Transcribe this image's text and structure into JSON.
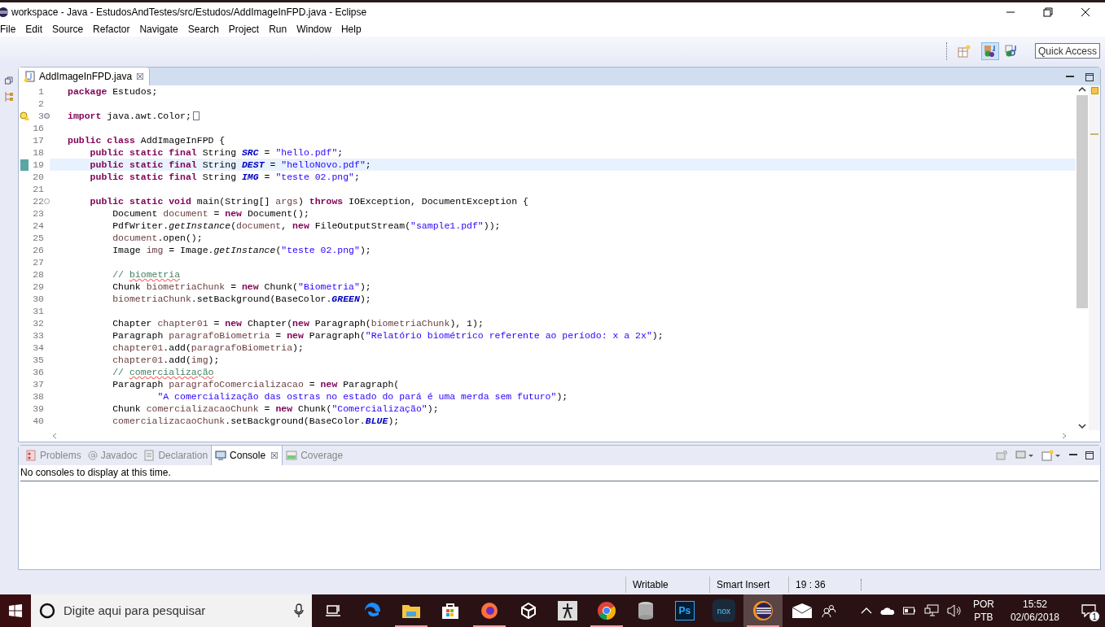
{
  "window": {
    "title": "workspace - Java - EstudosAndTestes/src/Estudos/AddImageInFPD.java - Eclipse"
  },
  "menu": [
    "File",
    "Edit",
    "Source",
    "Refactor",
    "Navigate",
    "Search",
    "Project",
    "Run",
    "Window",
    "Help"
  ],
  "toolbar": {
    "quick_access": "Quick Access",
    "buttons": [
      {
        "kind": "open-perspective",
        "selected": false
      },
      {
        "kind": "java-perspective",
        "selected": true
      },
      {
        "kind": "debug-perspective",
        "selected": false
      }
    ]
  },
  "editor": {
    "tab": {
      "label": "AddImageInFPD.java",
      "close": "☒"
    },
    "lines": [
      {
        "number": "1",
        "tokens": [
          {
            "kind": "keyword",
            "text": "package"
          },
          {
            "kind": "plain",
            "text": " Estudos;"
          }
        ]
      },
      {
        "number": "2"
      },
      {
        "number": "3",
        "warning": true,
        "expanded": false,
        "tokens": [
          {
            "kind": "keyword",
            "text": "import"
          },
          {
            "kind": "plain",
            "text": " java.awt.Color;"
          }
        ]
      },
      {
        "number": "16"
      },
      {
        "number": "17",
        "tokens": [
          {
            "kind": "keyword",
            "text": "public class"
          },
          {
            "kind": "plain",
            "text": " AddImageInFPD {"
          }
        ]
      },
      {
        "number": "18",
        "tokens": [
          {
            "kind": "keyword",
            "text": "    public static final"
          },
          {
            "kind": "plain",
            "text": " String "
          },
          {
            "kind": "constant",
            "text": "SRC"
          },
          {
            "kind": "plain",
            "text": " = "
          },
          {
            "kind": "string",
            "text": "\"hello.pdf\""
          },
          {
            "kind": "plain",
            "text": ";"
          }
        ]
      },
      {
        "number": "19",
        "current": true,
        "tokens": [
          {
            "kind": "keyword",
            "text": "    public static final"
          },
          {
            "kind": "plain",
            "text": " String "
          },
          {
            "kind": "constant",
            "text": "DEST"
          },
          {
            "kind": "plain",
            "text": " = "
          },
          {
            "kind": "string",
            "text": "\"helloNovo.pdf\""
          },
          {
            "kind": "plain",
            "text": ";"
          }
        ]
      },
      {
        "number": "20",
        "tokens": [
          {
            "kind": "keyword",
            "text": "    public static final"
          },
          {
            "kind": "plain",
            "text": " String "
          },
          {
            "kind": "constant",
            "text": "IMG"
          },
          {
            "kind": "plain",
            "text": " = "
          },
          {
            "kind": "string",
            "text": "\"teste 02.png\""
          },
          {
            "kind": "plain",
            "text": ";"
          }
        ]
      },
      {
        "number": "21"
      },
      {
        "number": "22",
        "expanded": true,
        "tokens": [
          {
            "kind": "keyword",
            "text": "    public static void"
          },
          {
            "kind": "plain",
            "text": " main(String[] "
          },
          {
            "kind": "local",
            "text": "args"
          },
          {
            "kind": "plain",
            "text": ") "
          },
          {
            "kind": "keyword",
            "text": "throws"
          },
          {
            "kind": "plain",
            "text": " IOException, DocumentException {"
          }
        ]
      },
      {
        "number": "23",
        "tokens": [
          {
            "kind": "plain",
            "text": "        Document "
          },
          {
            "kind": "local",
            "text": "document"
          },
          {
            "kind": "plain",
            "text": " = "
          },
          {
            "kind": "keyword",
            "text": "new"
          },
          {
            "kind": "plain",
            "text": " Document();"
          }
        ]
      },
      {
        "number": "24",
        "tokens": [
          {
            "kind": "plain",
            "text": "        PdfWriter."
          },
          {
            "kind": "static_method",
            "text": "getInstance"
          },
          {
            "kind": "plain",
            "text": "("
          },
          {
            "kind": "local",
            "text": "document"
          },
          {
            "kind": "plain",
            "text": ", "
          },
          {
            "kind": "keyword",
            "text": "new"
          },
          {
            "kind": "plain",
            "text": " FileOutputStream("
          },
          {
            "kind": "string",
            "text": "\"sample1.pdf\""
          },
          {
            "kind": "plain",
            "text": "));"
          }
        ]
      },
      {
        "number": "25",
        "tokens": [
          {
            "kind": "local",
            "text": "        document"
          },
          {
            "kind": "plain",
            "text": ".open();"
          }
        ]
      },
      {
        "number": "26",
        "tokens": [
          {
            "kind": "plain",
            "text": "        Image "
          },
          {
            "kind": "local",
            "text": "img"
          },
          {
            "kind": "plain",
            "text": " = Image."
          },
          {
            "kind": "static_method",
            "text": "getInstance"
          },
          {
            "kind": "plain",
            "text": "("
          },
          {
            "kind": "string",
            "text": "\"teste 02.png\""
          },
          {
            "kind": "plain",
            "text": ");"
          }
        ]
      },
      {
        "number": "27"
      },
      {
        "number": "28",
        "tokens": [
          {
            "kind": "comment",
            "text": "        // "
          },
          {
            "kind": "misspelled",
            "text": "biometria"
          }
        ]
      },
      {
        "number": "29",
        "tokens": [
          {
            "kind": "plain",
            "text": "        Chunk "
          },
          {
            "kind": "local",
            "text": "biometriaChunk"
          },
          {
            "kind": "plain",
            "text": " = "
          },
          {
            "kind": "keyword",
            "text": "new"
          },
          {
            "kind": "plain",
            "text": " Chunk("
          },
          {
            "kind": "string",
            "text": "\"Biometria\""
          },
          {
            "kind": "plain",
            "text": ");"
          }
        ]
      },
      {
        "number": "30",
        "tokens": [
          {
            "kind": "local",
            "text": "        biometriaChunk"
          },
          {
            "kind": "plain",
            "text": ".setBackground(BaseColor."
          },
          {
            "kind": "constant",
            "text": "GREEN"
          },
          {
            "kind": "plain",
            "text": ");"
          }
        ]
      },
      {
        "number": "31"
      },
      {
        "number": "32",
        "tokens": [
          {
            "kind": "plain",
            "text": "        Chapter "
          },
          {
            "kind": "local",
            "text": "chapter01"
          },
          {
            "kind": "plain",
            "text": " = "
          },
          {
            "kind": "keyword",
            "text": "new"
          },
          {
            "kind": "plain",
            "text": " Chapter("
          },
          {
            "kind": "keyword",
            "text": "new"
          },
          {
            "kind": "plain",
            "text": " Paragraph("
          },
          {
            "kind": "local",
            "text": "biometriaChunk"
          },
          {
            "kind": "plain",
            "text": "), 1);"
          }
        ]
      },
      {
        "number": "33",
        "tokens": [
          {
            "kind": "plain",
            "text": "        Paragraph "
          },
          {
            "kind": "local",
            "text": "paragrafoBiometria"
          },
          {
            "kind": "plain",
            "text": " = "
          },
          {
            "kind": "keyword",
            "text": "new"
          },
          {
            "kind": "plain",
            "text": " Paragraph("
          },
          {
            "kind": "string",
            "text": "\"Relatório biométrico referente ao período: x a 2x\""
          },
          {
            "kind": "plain",
            "text": ");"
          }
        ]
      },
      {
        "number": "34",
        "tokens": [
          {
            "kind": "local",
            "text": "        chapter01"
          },
          {
            "kind": "plain",
            "text": ".add("
          },
          {
            "kind": "local",
            "text": "paragrafoBiometria"
          },
          {
            "kind": "plain",
            "text": ");"
          }
        ]
      },
      {
        "number": "35",
        "tokens": [
          {
            "kind": "local",
            "text": "        chapter01"
          },
          {
            "kind": "plain",
            "text": ".add("
          },
          {
            "kind": "local",
            "text": "img"
          },
          {
            "kind": "plain",
            "text": ");"
          }
        ]
      },
      {
        "number": "36",
        "tokens": [
          {
            "kind": "comment",
            "text": "        // "
          },
          {
            "kind": "misspelled",
            "text": "comercialização"
          }
        ]
      },
      {
        "number": "37",
        "tokens": [
          {
            "kind": "plain",
            "text": "        Paragraph "
          },
          {
            "kind": "local",
            "text": "paragrafoComercializacao"
          },
          {
            "kind": "plain",
            "text": " = "
          },
          {
            "kind": "keyword",
            "text": "new"
          },
          {
            "kind": "plain",
            "text": " Paragraph("
          }
        ]
      },
      {
        "number": "38",
        "tokens": [
          {
            "kind": "string",
            "text": "                \"A comercialização das ostras no estado do pará é uma merda sem futuro\""
          },
          {
            "kind": "plain",
            "text": ");"
          }
        ]
      },
      {
        "number": "39",
        "tokens": [
          {
            "kind": "plain",
            "text": "        Chunk "
          },
          {
            "kind": "local",
            "text": "comercializacaoChunk"
          },
          {
            "kind": "plain",
            "text": " = "
          },
          {
            "kind": "keyword",
            "text": "new"
          },
          {
            "kind": "plain",
            "text": " Chunk("
          },
          {
            "kind": "string",
            "text": "\"Comercialização\""
          },
          {
            "kind": "plain",
            "text": ");"
          }
        ]
      },
      {
        "number": "40",
        "tokens": [
          {
            "kind": "local",
            "text": "        comercializacaoChunk"
          },
          {
            "kind": "plain",
            "text": ".setBackground(BaseColor."
          },
          {
            "kind": "constant",
            "text": "BLUE"
          },
          {
            "kind": "plain",
            "text": ");"
          }
        ]
      }
    ]
  },
  "bottom_panel": {
    "tabs": [
      {
        "label": "Problems",
        "kind": "problems",
        "selected": false
      },
      {
        "label": "Javadoc",
        "kind": "javadoc",
        "selected": false
      },
      {
        "label": "Declaration",
        "kind": "declaration",
        "selected": false
      },
      {
        "label": "Console",
        "kind": "console",
        "selected": true,
        "close": "☒"
      },
      {
        "label": "Coverage",
        "kind": "coverage",
        "selected": false
      }
    ],
    "message": "No consoles to display at this time."
  },
  "status_bar": {
    "writable": "Writable",
    "insert_mode": "Smart Insert",
    "position": "19 : 36"
  },
  "taskbar": {
    "search_placeholder": "Digite aqui para pesquisar",
    "apps": [
      {
        "kind": "task-view",
        "running": false,
        "active": false
      },
      {
        "kind": "edge",
        "running": false,
        "active": false
      },
      {
        "kind": "folder",
        "running": true,
        "active": false
      },
      {
        "kind": "store",
        "running": false,
        "active": false
      },
      {
        "kind": "firefox",
        "running": true,
        "active": false
      },
      {
        "kind": "unity",
        "running": false,
        "active": false
      },
      {
        "kind": "zbrush",
        "running": false,
        "active": false
      },
      {
        "kind": "chrome",
        "running": true,
        "active": false
      },
      {
        "kind": "database",
        "running": false,
        "active": false
      },
      {
        "kind": "photoshop",
        "running": false,
        "active": false
      },
      {
        "kind": "nox",
        "running": false,
        "active": false
      },
      {
        "kind": "eclipse",
        "running": true,
        "active": true
      },
      {
        "kind": "mail",
        "running": false,
        "active": false
      }
    ],
    "ps_label": "Ps",
    "nox_label": "nox",
    "language": [
      "POR",
      "PTB"
    ],
    "time": "15:52",
    "date": "02/06/2018",
    "notifications": "1"
  }
}
